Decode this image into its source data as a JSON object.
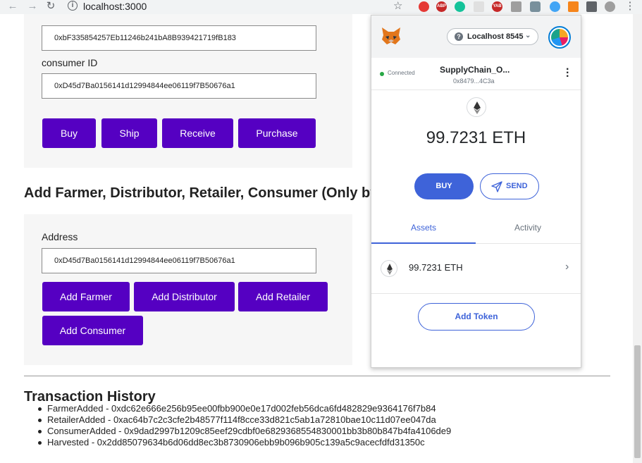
{
  "browser": {
    "url": "localhost:3000",
    "extensions": [
      {
        "name": "adblock",
        "color": "#e53935",
        "text": ""
      },
      {
        "name": "abp",
        "color": "#c62828",
        "text": "ABP"
      },
      {
        "name": "grammarly",
        "color": "#15c39a",
        "text": ""
      },
      {
        "name": "ext-gray",
        "color": "#bdbdbd",
        "text": ""
      },
      {
        "name": "yab",
        "color": "#c62828",
        "text": "YAB"
      },
      {
        "name": "ext-gray-2",
        "color": "#9e9e9e",
        "text": ""
      },
      {
        "name": "shield",
        "color": "#78909c",
        "text": ""
      },
      {
        "name": "feather",
        "color": "#42a5f5",
        "text": ""
      }
    ]
  },
  "form_top": {
    "farmer_address": "0xbF335854257Eb11246b241bA8B939421719fB183",
    "consumer_label": "consumer ID",
    "consumer_id": "0xD45d7Ba0156141d12994844ee06119f7B50676a1",
    "buttons": [
      "Buy",
      "Ship",
      "Receive",
      "Purchase"
    ]
  },
  "roles": {
    "title": "Add Farmer, Distributor, Retailer, Consumer (Only by the",
    "address_label": "Address",
    "address_value": "0xD45d7Ba0156141d12994844ee06119f7B50676a1",
    "buttons": [
      "Add Farmer",
      "Add Distributor",
      "Add Retailer",
      "Add Consumer"
    ]
  },
  "history": {
    "title": "Transaction History",
    "items": [
      "FarmerAdded - 0xdc62e666e256b95ee00fbb900e0e17d002feb56dca6fd482829e9364176f7b84",
      "RetailerAdded - 0xac64b7c2c3cfe2b48577f114f8cce33d821c5ab1a72810bae10c11d07ee047da",
      "ConsumerAdded - 0x9dad2997b1209c85eef29cdbf0e6829368554830001bb3b80b847b4fa4106de9",
      "Harvested - 0x2dd85079634b6d06dd8ec3b8730906ebb9b096b905c139a5c9acecfdfd31350c"
    ]
  },
  "metamask": {
    "network": "Localhost 8545",
    "connected": "Connected",
    "account_name": "SupplyChain_O...",
    "account_address": "0x8479...4C3a",
    "balance": "99.7231 ETH",
    "buy": "BUY",
    "send": "SEND",
    "tabs": [
      "Assets",
      "Activity"
    ],
    "asset": "99.7231 ETH",
    "add_token": "Add Token"
  }
}
